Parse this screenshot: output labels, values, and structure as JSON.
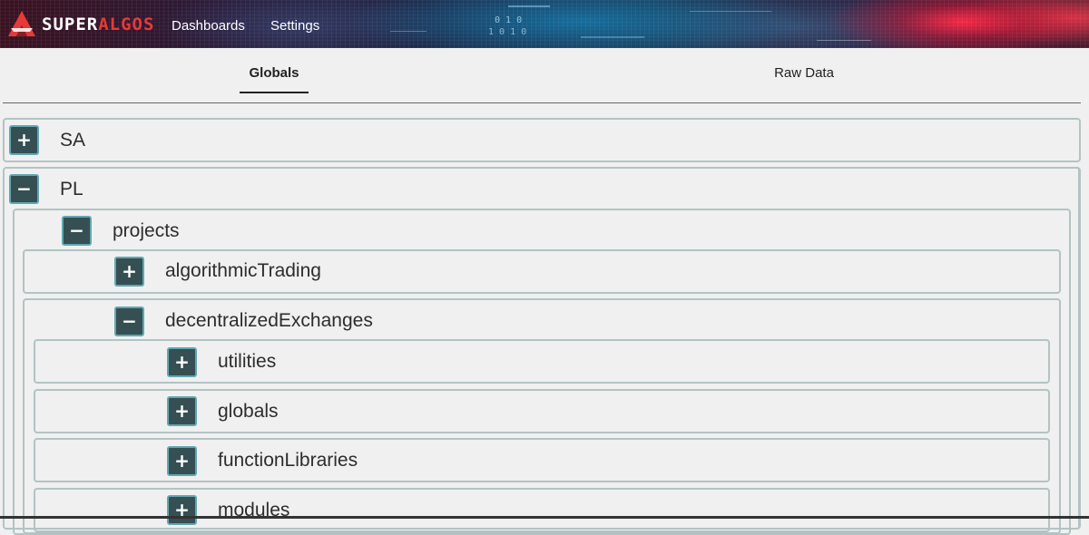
{
  "header": {
    "logo": {
      "super": "SUPER",
      "algos": "ALGOS"
    },
    "nav": [
      {
        "label": "Dashboards"
      },
      {
        "label": "Settings"
      }
    ],
    "banner_digits": [
      "0 1 0",
      "1 0 1 0"
    ]
  },
  "tabs": [
    {
      "label": "Globals",
      "active": true
    },
    {
      "label": "Raw Data",
      "active": false
    }
  ],
  "tree": {
    "expand_symbol": "+",
    "collapse_symbol": "−",
    "nodes": [
      {
        "label": "SA",
        "expanded": false,
        "depth": 0
      },
      {
        "label": "PL",
        "expanded": true,
        "depth": 0
      },
      {
        "label": "projects",
        "expanded": true,
        "depth": 1
      },
      {
        "label": "algorithmicTrading",
        "expanded": false,
        "depth": 2
      },
      {
        "label": "decentralizedExchanges",
        "expanded": true,
        "depth": 2
      },
      {
        "label": "utilities",
        "expanded": false,
        "depth": 3
      },
      {
        "label": "globals",
        "expanded": false,
        "depth": 3
      },
      {
        "label": "functionLibraries",
        "expanded": false,
        "depth": 3
      },
      {
        "label": "modules",
        "expanded": false,
        "depth": 3
      }
    ]
  },
  "colors": {
    "toggle_bg": "#364f52",
    "toggle_border": "#5fa8b2",
    "node_border": "#b3c3c3",
    "logo_accent": "#e63a38",
    "page_bg": "#f0f0f0"
  }
}
